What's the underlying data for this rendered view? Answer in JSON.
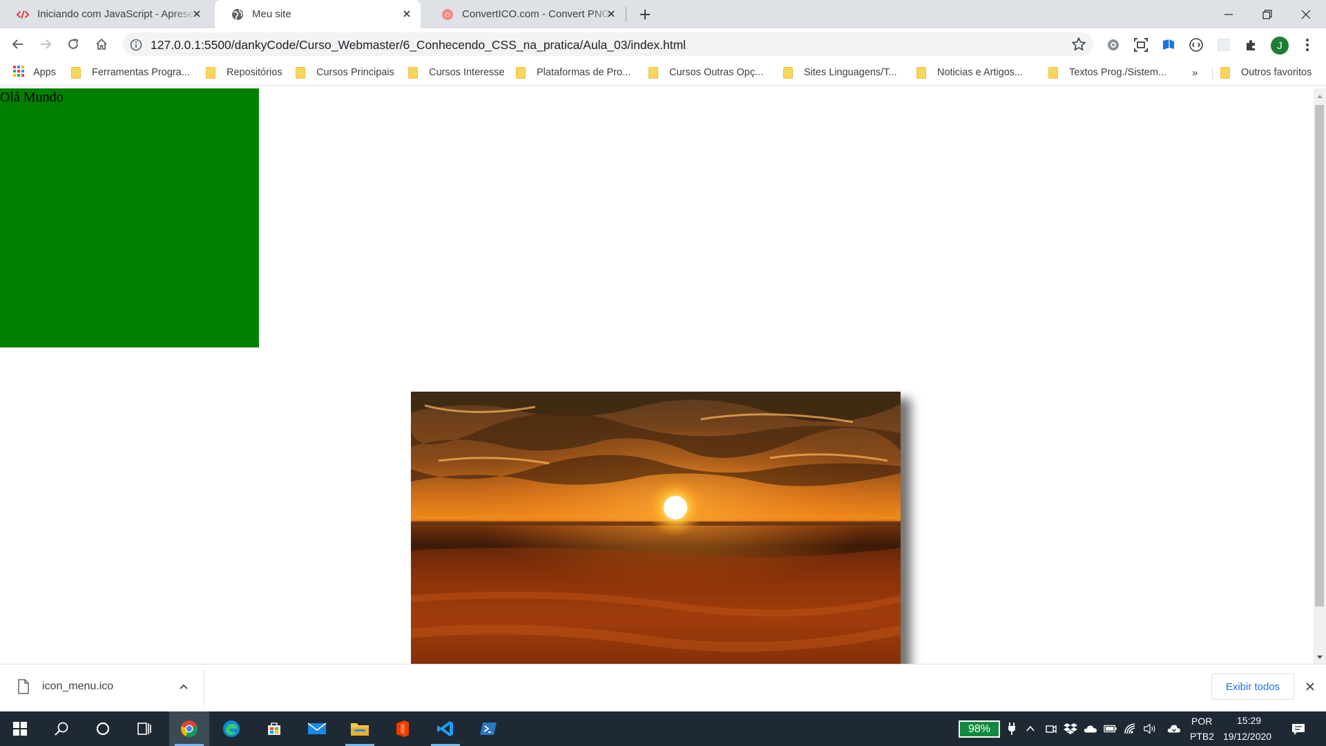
{
  "browser": {
    "tabs": [
      {
        "title": "Iniciando com JavaScript - Apresentação",
        "favicon": "code-icon",
        "active": false
      },
      {
        "title": "Meu site",
        "favicon": "globe-icon",
        "active": true
      },
      {
        "title": "ConvertICO.com - Convert PNG to ICO",
        "favicon": "converticon-icon",
        "active": false
      }
    ],
    "new_tab_icon": "plus-icon",
    "window_controls": [
      "minimize-icon",
      "restore-icon",
      "close-icon"
    ]
  },
  "toolbar": {
    "url": "127.0.0.1:5500/dankyCode/Curso_Webmaster/6_Conhecendo_CSS_na_pratica/Aula_03/index.html",
    "profile_initial": "J",
    "profile_color": "#1e7e34"
  },
  "bookmarks": {
    "apps_label": "Apps",
    "items": [
      "Ferramentas Progra...",
      "Repositórios",
      "Cursos Principais",
      "Cursos Interesse",
      "Plataformas de Pro...",
      "Cursos Outras Opç...",
      "Sites Linguagens/T...",
      "Noticias e Artigos...",
      "Textos Prog./Sistem..."
    ],
    "overflow_label": "»",
    "other_label": "Outros favoritos"
  },
  "page": {
    "greeting": "Olá Mundo",
    "box_color": "#008000",
    "image_description": "sunset-over-field"
  },
  "downloads": {
    "file_name": "icon_menu.ico",
    "show_all_label": "Exibir todos"
  },
  "taskbar": {
    "battery": "98%",
    "lang_top": "POR",
    "lang_bottom": "PTB2",
    "time": "15:29",
    "date": "19/12/2020"
  }
}
